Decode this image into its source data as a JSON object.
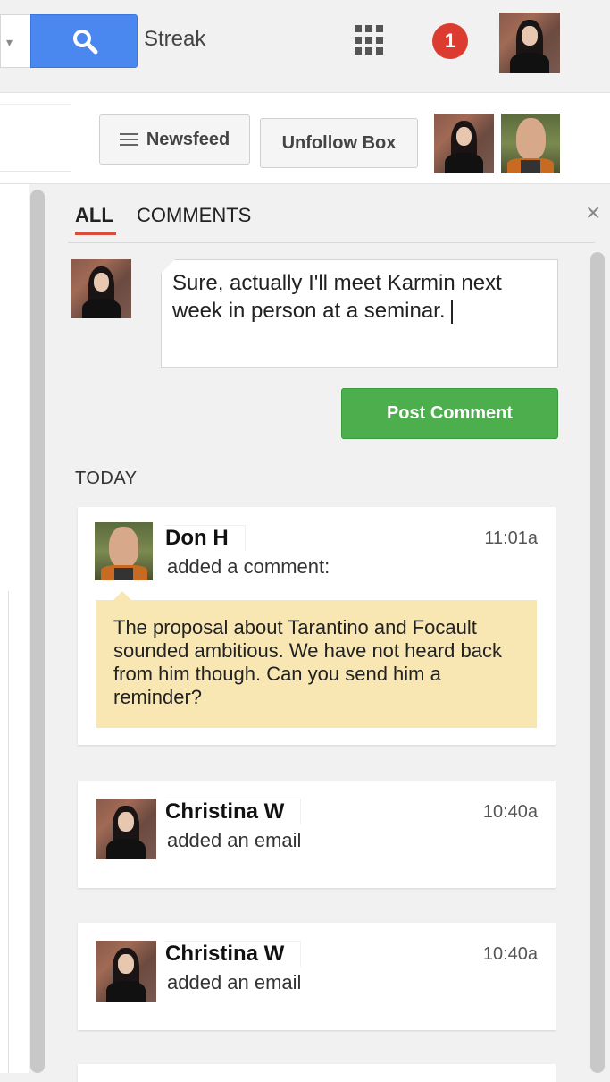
{
  "topbar": {
    "app_name": "Streak",
    "notification_count": "1"
  },
  "toolbar": {
    "newsfeed_label": "Newsfeed",
    "unfollow_label": "Unfollow Box"
  },
  "panel": {
    "tabs": [
      {
        "label": "ALL"
      },
      {
        "label": "COMMENTS"
      }
    ],
    "close_label": "×",
    "compose_text": "Sure, actually I'll meet Karmin next week in person at a seminar.",
    "post_button_label": "Post Comment",
    "section_label": "TODAY",
    "feed": [
      {
        "author": "Don H",
        "action": "added a comment:",
        "time": "11:01a",
        "comment": "The proposal about Tarantino and Focault sounded ambitious. We have not heard back from him though. Can you send him a reminder?"
      },
      {
        "author": "Christina W",
        "action": "added an email",
        "time": "10:40a"
      },
      {
        "author": "Christina W",
        "action": "added an email",
        "time": "10:40a"
      }
    ]
  },
  "colors": {
    "search_blue": "#4a87ee",
    "notif_red": "#dc3b30",
    "post_green": "#4cae4c",
    "tab_underline": "#dd4b39",
    "note_yellow": "#f9e7b3"
  },
  "icons": {
    "search": "search-icon",
    "apps": "apps-grid-icon",
    "newsfeed": "hamburger-icon",
    "close": "close-icon",
    "dropdown": "chevron-down-icon"
  }
}
